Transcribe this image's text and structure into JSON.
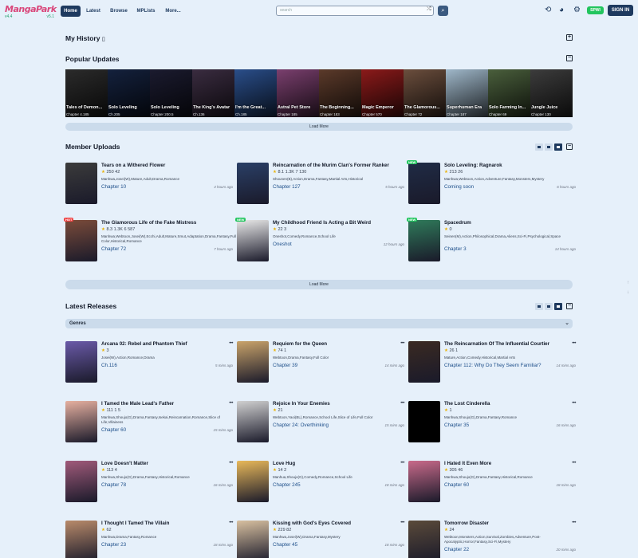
{
  "brand": {
    "logo": "MangaPark",
    "ver_left": "v4.4",
    "ver_right": "v5.1"
  },
  "nav": {
    "home": "Home",
    "latest": "Latest",
    "browse": "Browse",
    "mplists": "MPLists",
    "more": "More..."
  },
  "search": {
    "placeholder": "search",
    "shuffle_icon": "shuffle-icon",
    "search_icon": "search-icon"
  },
  "topbar": {
    "history_icon": "history-icon",
    "palette_icon": "palette-icon",
    "settings_icon": "gear-icon",
    "spwi": "SPWI",
    "signin": "SIGN IN"
  },
  "my_history": {
    "title": "My History"
  },
  "popular": {
    "title": "Popular Updates",
    "load_more": "Load More",
    "items": [
      {
        "title": "Tales of Demon...",
        "ch": "Chapter 4.185",
        "color": "#2b2b2b"
      },
      {
        "title": "Solo Leveling",
        "ch": "Ch.205",
        "color": "#14213d"
      },
      {
        "title": "Solo Leveling",
        "ch": "Chapter 200.5",
        "color": "#1b1b2f"
      },
      {
        "title": "The King's Avatar",
        "ch": "Ch.136",
        "color": "#3a2c40"
      },
      {
        "title": "I'm the Great...",
        "ch": "Ch.185",
        "color": "#2a4e8a"
      },
      {
        "title": "Astral Pet Store",
        "ch": "Chapter 185",
        "color": "#7a3f6e"
      },
      {
        "title": "The Beginning...",
        "ch": "Chapter 183",
        "color": "#5b3a2a"
      },
      {
        "title": "Magic Emperor",
        "ch": "Chapter 570",
        "color": "#8b1a1a"
      },
      {
        "title": "The Glamorous...",
        "ch": "Chapter 72",
        "color": "#6b4e3d"
      },
      {
        "title": "Superhuman Era",
        "ch": "Chapter 187",
        "color": "#9fb7c9"
      },
      {
        "title": "Solo Farming In...",
        "ch": "Chapter 69",
        "color": "#4a5f3c"
      },
      {
        "title": "Jungle Juice",
        "ch": "Chapter 130",
        "color": "#3c3c3c"
      }
    ]
  },
  "member_uploads": {
    "title": "Member Uploads",
    "load_more": "Load More",
    "items": [
      {
        "title": "Tears on a Withered Flower",
        "meta": "250   42",
        "genres": "Manhwa,Josei(W),Mature,Adult,Drama,Romance",
        "chapter": "Chapter 10",
        "time": "4 hours ago",
        "color": "#3b3b3b",
        "badge": ""
      },
      {
        "title": "Reincarnation of the Murim Clan's Former Ranker",
        "meta": "8.1   1.3K   7   130",
        "genres": "Shounen(B),Action,Drama,Fantasy,Martial Arts,Historical",
        "chapter": "Chapter 127",
        "time": "5 hours ago",
        "color": "#2a3f66",
        "badge": ""
      },
      {
        "title": "Solo Leveling: Ragnarok",
        "meta": "213   26",
        "genres": "Manhwa,Webtoon,Action,Adventure,Fantasy,Monsters,Mystery",
        "chapter": "Coming soon",
        "time": "6 hours ago",
        "color": "#1f2b45",
        "badge": "NEW"
      },
      {
        "title": "The Glamorous Life of the Fake Mistress",
        "meta": "8.3   1.3K   6   587",
        "genres": "Manhwa,Webtoon,Josei(W),Ecchi,Adult,Mature,Smut,Adaptation,Drama,Fantasy,Full Color,Historical,Romance",
        "chapter": "Chapter 72",
        "time": "7 hours ago",
        "color": "#7a4b3a",
        "badge": "HOT"
      },
      {
        "title": "My Childhood Friend Is Acting a Bit Weird",
        "meta": "22   3",
        "genres": "Oneshot,Comedy,Romance,School Life",
        "chapter": "Oneshot",
        "time": "12 hours ago",
        "color": "#e8e8e8",
        "badge": "NEW"
      },
      {
        "title": "Spacedrum",
        "meta": "0",
        "genres": "Seinen(M),Action,Philosophical,Drama,Aliens,Sci-Fi,Psychological,Space",
        "chapter": "Chapter 3",
        "time": "14 hours ago",
        "color": "#2f7a5a",
        "badge": "NEW"
      }
    ]
  },
  "latest": {
    "title": "Latest Releases",
    "genres": "Genres",
    "items": [
      {
        "title": "Arcana 02: Rebel and Phantom Thief",
        "meta": "3",
        "genres": "Josei(W),Action,Romance,Drama",
        "chapter": "Ch.116",
        "time": "5 mins ago",
        "color": "#6a5aa8"
      },
      {
        "title": "Requiem for the Queen",
        "meta": "74   1",
        "genres": "Webtoon,Drama,Fantasy,Full Color",
        "chapter": "Chapter 39",
        "time": "14 mins ago",
        "color": "#c9a36a"
      },
      {
        "title": "The Reincarnation Of The Influential Courtier",
        "meta": "26   1",
        "genres": "Mature,Action,Comedy,Historical,Martial Arts",
        "chapter": "Chapter 112: Why Do They Seem Familiar?",
        "time": "14 mins ago",
        "color": "#3a2a22"
      },
      {
        "title": "I Tamed the Male Lead's Father",
        "meta": "111   1   5",
        "genres": "Manhwa,Shoujo(G),Drama,Fantasy,Isekai,Reincarnation,Romance,Slice of Life,Villainess",
        "chapter": "Chapter 60",
        "time": "15 mins ago",
        "color": "#e6b0a0"
      },
      {
        "title": "Rejoice In Your Enemies",
        "meta": "21",
        "genres": "Webtoon,Yaoi(BL),Romance,School Life,Slice of Life,Full Color",
        "chapter": "Chapter 24: Overthinking",
        "time": "15 mins ago",
        "color": "#d0d0d0"
      },
      {
        "title": "The Lost Cinderella",
        "meta": "1",
        "genres": "Manhwa,Shoujo(G),Drama,Fantasy,Romance",
        "chapter": "Chapter 35",
        "time": "16 mins ago",
        "color": "#000000"
      },
      {
        "title": "Love Doesn't Matter",
        "meta": "113   4",
        "genres": "Manhwa,Shoujo(G),Drama,Fantasy,Historical,Romance",
        "chapter": "Chapter 78",
        "time": "16 mins ago",
        "color": "#a05a7a"
      },
      {
        "title": "Love Hug",
        "meta": "14   2",
        "genres": "Manhua,Shoujo(G),Comedy,Romance,School Life",
        "chapter": "Chapter 245",
        "time": "18 mins ago",
        "color": "#e8b85a"
      },
      {
        "title": "I Hated It Even More",
        "meta": "305   46",
        "genres": "Manhwa,Shoujo(G),Drama,Fantasy,Historical,Romance",
        "chapter": "Chapter 60",
        "time": "18 mins ago",
        "color": "#c86a8a"
      },
      {
        "title": "I Thought I Tamed The Villain",
        "meta": "62",
        "genres": "Manhwa,Drama,Fantasy,Romance",
        "chapter": "Chapter 23",
        "time": "18 mins ago",
        "color": "#b88a6a"
      },
      {
        "title": "Kissing with God's Eyes Covered",
        "meta": "229   82",
        "genres": "Manhwa,Josei(W),Drama,Fantasy,Mystery",
        "chapter": "Chapter 45",
        "time": "18 mins ago",
        "color": "#d8c0a0"
      },
      {
        "title": "Tomorrow Disaster",
        "meta": "24",
        "genres": "Webtoon,Monsters,Action,Survival,Zombies,Adventure,Post-Apocalyptic,Horror,Fantasy,Sci-Fi,Mystery",
        "chapter": "Chapter 22",
        "time": "20 mins ago",
        "color": "#5a4a3a"
      }
    ]
  }
}
